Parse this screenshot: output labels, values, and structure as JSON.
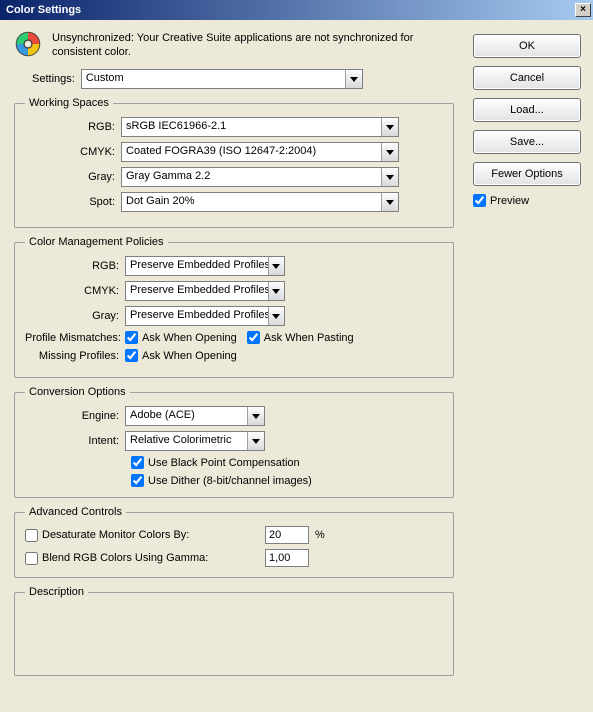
{
  "title": "Color Settings",
  "sync_message": "Unsynchronized: Your Creative Suite applications are not synchronized for consistent color.",
  "settings_label": "Settings:",
  "settings_value": "Custom",
  "buttons": {
    "ok": "OK",
    "cancel": "Cancel",
    "load": "Load...",
    "save": "Save...",
    "fewer": "Fewer Options"
  },
  "preview_label": "Preview",
  "working_spaces": {
    "legend": "Working Spaces",
    "rgb_label": "RGB:",
    "rgb_value": "sRGB IEC61966-2.1",
    "cmyk_label": "CMYK:",
    "cmyk_value": "Coated FOGRA39 (ISO 12647-2:2004)",
    "gray_label": "Gray:",
    "gray_value": "Gray Gamma 2.2",
    "spot_label": "Spot:",
    "spot_value": "Dot Gain 20%"
  },
  "policies": {
    "legend": "Color Management Policies",
    "rgb_label": "RGB:",
    "rgb_value": "Preserve Embedded Profiles",
    "cmyk_label": "CMYK:",
    "cmyk_value": "Preserve Embedded Profiles",
    "gray_label": "Gray:",
    "gray_value": "Preserve Embedded Profiles",
    "mismatch_label": "Profile Mismatches:",
    "ask_open": "Ask When Opening",
    "ask_paste": "Ask When Pasting",
    "missing_label": "Missing Profiles:",
    "missing_ask": "Ask When Opening"
  },
  "conversion": {
    "legend": "Conversion Options",
    "engine_label": "Engine:",
    "engine_value": "Adobe (ACE)",
    "intent_label": "Intent:",
    "intent_value": "Relative Colorimetric",
    "bpc": "Use Black Point Compensation",
    "dither": "Use Dither (8-bit/channel images)"
  },
  "advanced": {
    "legend": "Advanced Controls",
    "desat_label": "Desaturate Monitor Colors By:",
    "desat_value": "20",
    "desat_unit": "%",
    "blend_label": "Blend RGB Colors Using Gamma:",
    "blend_value": "1,00"
  },
  "description": {
    "legend": "Description"
  }
}
